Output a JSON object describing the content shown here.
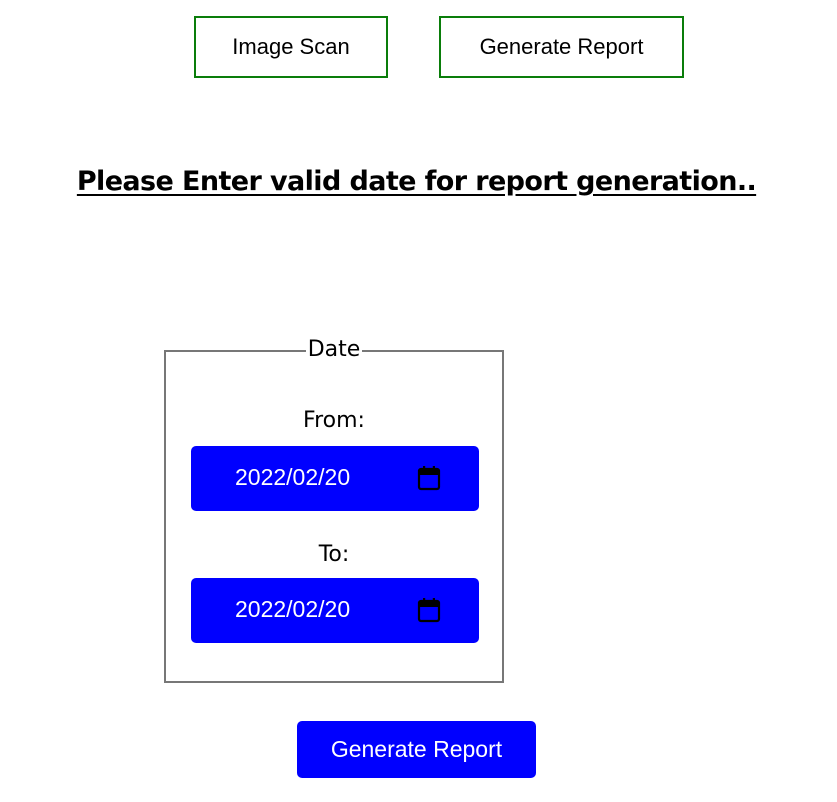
{
  "nav": {
    "image_scan_label": "Image Scan",
    "generate_report_label": "Generate Report",
    "border_color": "#0a7d0a"
  },
  "message": "Please Enter valid date for report generation..",
  "date_form": {
    "legend": "Date",
    "from_label": "From:",
    "from_value": "2022/02/20",
    "to_label": "To:",
    "to_value": "2022/02/20",
    "calendar_icon": "calendar-icon",
    "input_bg_color": "#0000ff"
  },
  "submit": {
    "label": "Generate Report",
    "bg_color": "#0000ff"
  }
}
